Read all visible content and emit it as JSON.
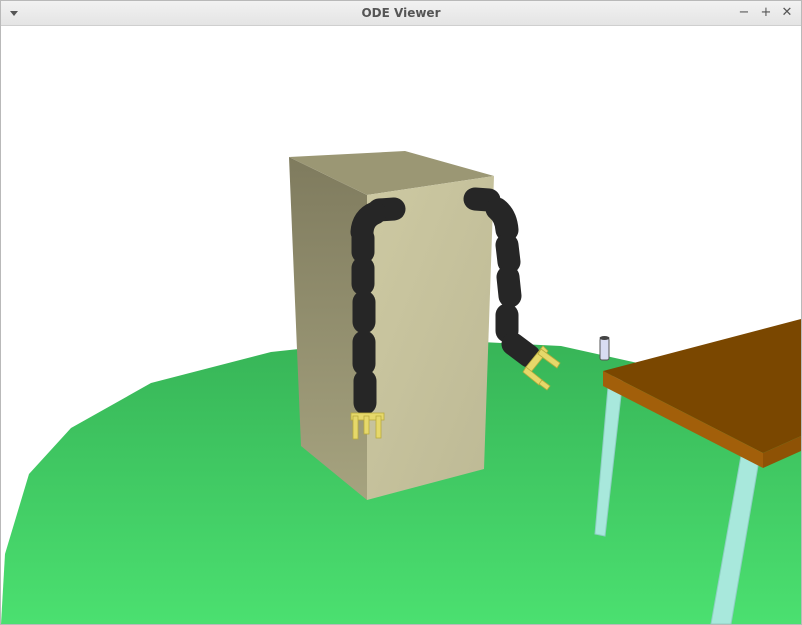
{
  "window": {
    "title": "ODE Viewer",
    "controls": {
      "menu_icon": "triangle-down-icon",
      "minimize_glyph": "−",
      "maximize_glyph": "+",
      "close_glyph": "✕"
    }
  },
  "scene": {
    "objects": [
      "green-ground-disc",
      "beige-box",
      "snake-chain-left",
      "snake-chain-right",
      "gripper-left",
      "gripper-right",
      "brown-table",
      "cyan-table-legs",
      "small-cylinder"
    ],
    "colors": {
      "background": "#ffffff",
      "ground": "#48d56a",
      "box_front": "#c9c59e",
      "box_side": "#8f8b68",
      "box_top": "#9f9b78",
      "chain": "#262626",
      "gripper": "#e6d86a",
      "table_top": "#7a4700",
      "table_leg": "#a8e8dc"
    }
  }
}
